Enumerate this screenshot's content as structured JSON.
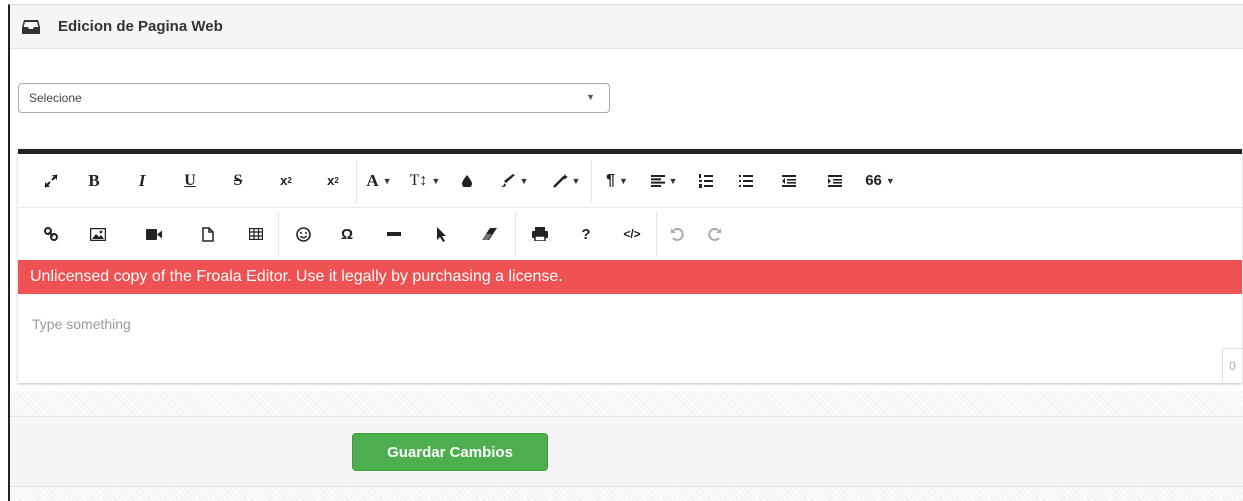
{
  "panel": {
    "title": "Edicion de Pagina Web",
    "icon": "inbox-icon"
  },
  "select": {
    "value": "Selecione"
  },
  "toolbar": {
    "row1": [
      {
        "name": "fullscreen-icon"
      },
      {
        "name": "bold-icon",
        "label": "B"
      },
      {
        "name": "italic-icon",
        "label": "I"
      },
      {
        "name": "underline-icon",
        "label": "U"
      },
      {
        "name": "strikethrough-icon",
        "label": "S"
      },
      {
        "name": "subscript-icon",
        "label": "x₂"
      },
      {
        "name": "superscript-icon",
        "label": "x²"
      },
      {
        "name": "font-family-icon",
        "label": "A"
      },
      {
        "name": "font-size-icon",
        "label": "T↕"
      },
      {
        "name": "color-icon"
      },
      {
        "name": "inline-style-icon"
      },
      {
        "name": "paragraph-style-icon"
      },
      {
        "name": "paragraph-format-icon",
        "label": "¶"
      },
      {
        "name": "align-icon"
      },
      {
        "name": "ordered-list-icon"
      },
      {
        "name": "unordered-list-icon"
      },
      {
        "name": "outdent-icon"
      },
      {
        "name": "indent-icon"
      },
      {
        "name": "quote-icon",
        "label": "66"
      }
    ],
    "row2": [
      {
        "name": "link-icon"
      },
      {
        "name": "image-icon"
      },
      {
        "name": "video-icon"
      },
      {
        "name": "file-icon"
      },
      {
        "name": "table-icon"
      },
      {
        "name": "emoticon-icon"
      },
      {
        "name": "special-characters-icon",
        "label": "Ω"
      },
      {
        "name": "horizontal-line-icon"
      },
      {
        "name": "select-all-icon"
      },
      {
        "name": "clear-formatting-icon"
      },
      {
        "name": "print-icon"
      },
      {
        "name": "help-icon",
        "label": "?"
      },
      {
        "name": "code-view-icon",
        "label": "</>"
      },
      {
        "name": "undo-icon"
      },
      {
        "name": "redo-icon"
      }
    ]
  },
  "editor": {
    "license_notice": "Unlicensed copy of the Froala Editor. Use it legally by purchasing a license.",
    "placeholder": "Type something",
    "char_count": "0"
  },
  "footer": {
    "save_label": "Guardar Cambios"
  },
  "colors": {
    "license_bar": "#ee5252",
    "save_button": "#4cae4c",
    "toolbar_top_border": "#222222"
  }
}
